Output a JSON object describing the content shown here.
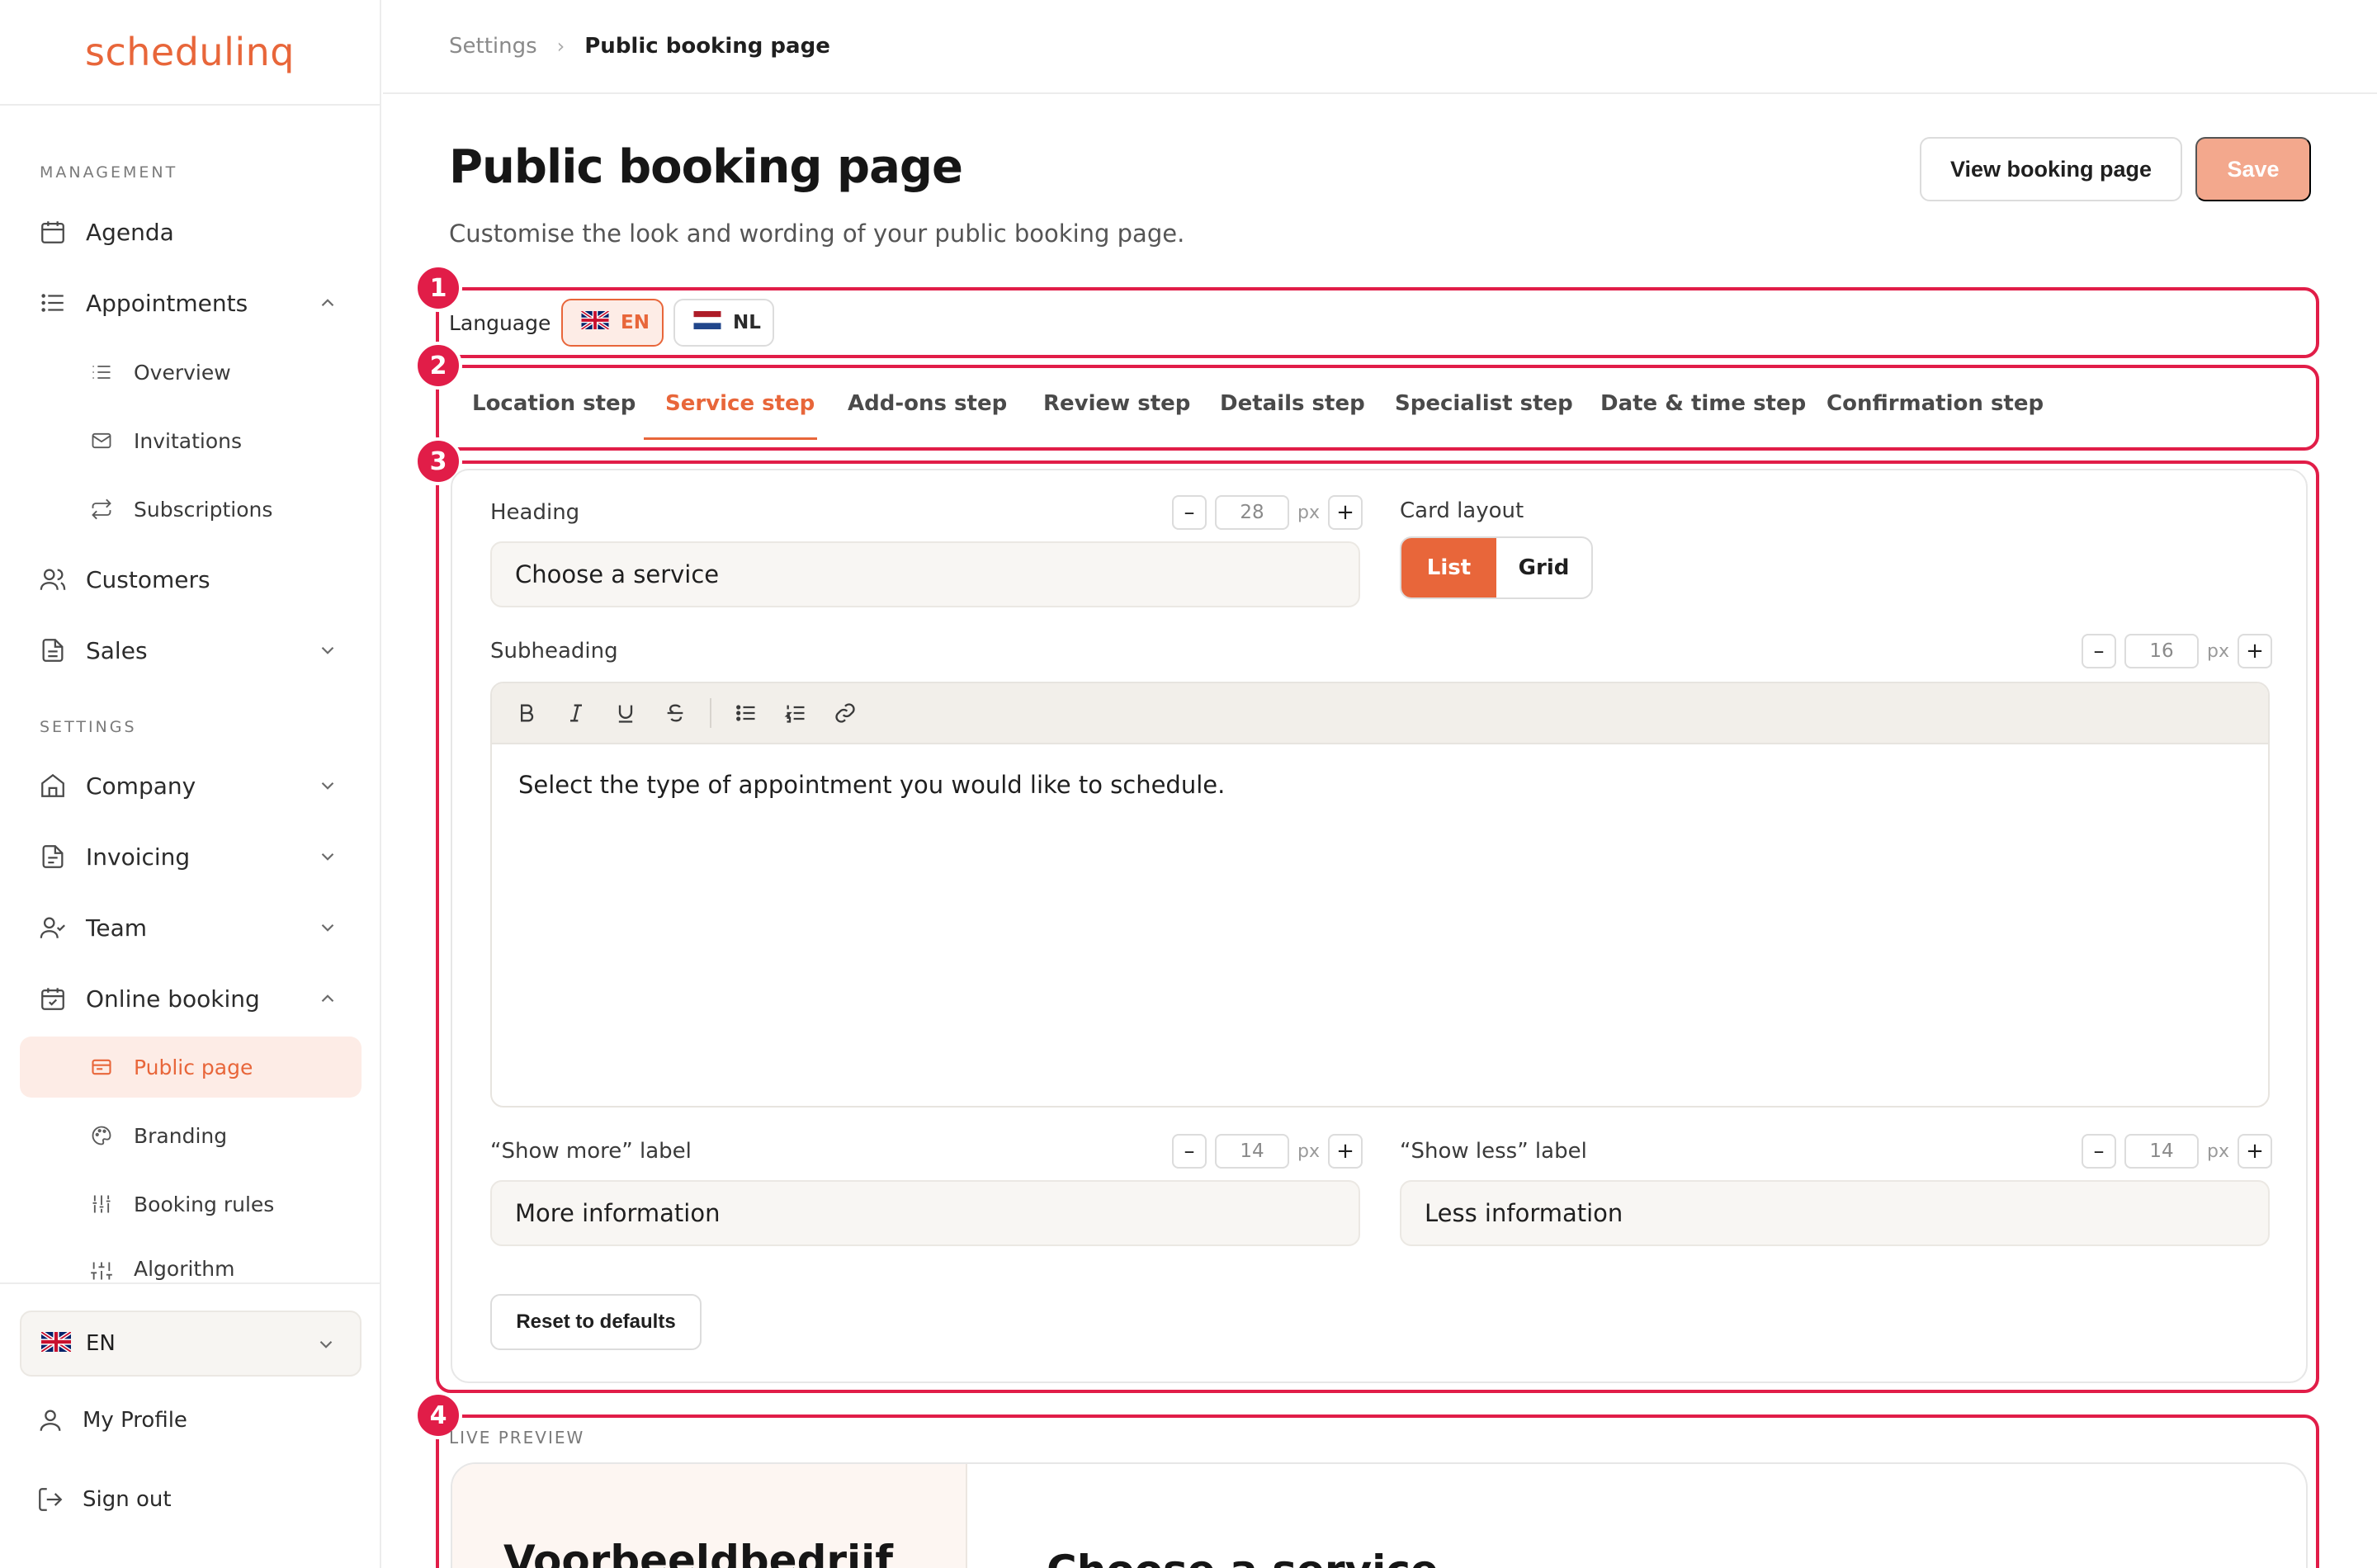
{
  "app": {
    "logo_text": "schedulinq",
    "brand_color": "#e8663a"
  },
  "sidebar": {
    "management_label": "MANAGEMENT",
    "settings_label": "SETTINGS",
    "agenda": "Agenda",
    "appointments": "Appointments",
    "overview": "Overview",
    "invitations": "Invitations",
    "subscriptions": "Subscriptions",
    "customers": "Customers",
    "sales": "Sales",
    "company": "Company",
    "invoicing": "Invoicing",
    "team": "Team",
    "online_booking": "Online booking",
    "public_page": "Public page",
    "branding": "Branding",
    "booking_rules": "Booking rules",
    "algorithm": "Algorithm",
    "language": "EN",
    "my_profile": "My Profile",
    "sign_out": "Sign out"
  },
  "breadcrumb": {
    "parent": "Settings",
    "current": "Public booking page"
  },
  "header": {
    "title": "Public booking page",
    "subtitle": "Customise the look and wording of your public booking page.",
    "view_button": "View booking page",
    "save_button": "Save"
  },
  "annotations": [
    "1",
    "2",
    "3",
    "4"
  ],
  "language_row": {
    "label": "Language",
    "options": [
      "EN",
      "NL"
    ],
    "selected": "EN"
  },
  "tabs": [
    "Location step",
    "Service step",
    "Add-ons step",
    "Review step",
    "Details step",
    "Specialist step",
    "Date & time step",
    "Confirmation step"
  ],
  "active_tab": "Service step",
  "form": {
    "heading_label": "Heading",
    "heading_size": "28",
    "heading_value": "Choose a service",
    "size_unit": "px",
    "card_layout_label": "Card layout",
    "card_layout_options": [
      "List",
      "Grid"
    ],
    "card_layout_selected": "List",
    "subheading_label": "Subheading",
    "subheading_size": "16",
    "subheading_value": "Select the type of appointment you would like to schedule.",
    "show_more_label": "“Show more” label",
    "show_more_size": "14",
    "show_more_value": "More information",
    "show_less_label": "“Show less” label",
    "show_less_size": "14",
    "show_less_value": "Less information",
    "reset_button": "Reset to defaults",
    "stepper_minus": "–",
    "stepper_plus": "+"
  },
  "preview": {
    "label": "LIVE PREVIEW",
    "company_name": "Voorbeeldbedrijf",
    "heading": "Choose a service"
  }
}
